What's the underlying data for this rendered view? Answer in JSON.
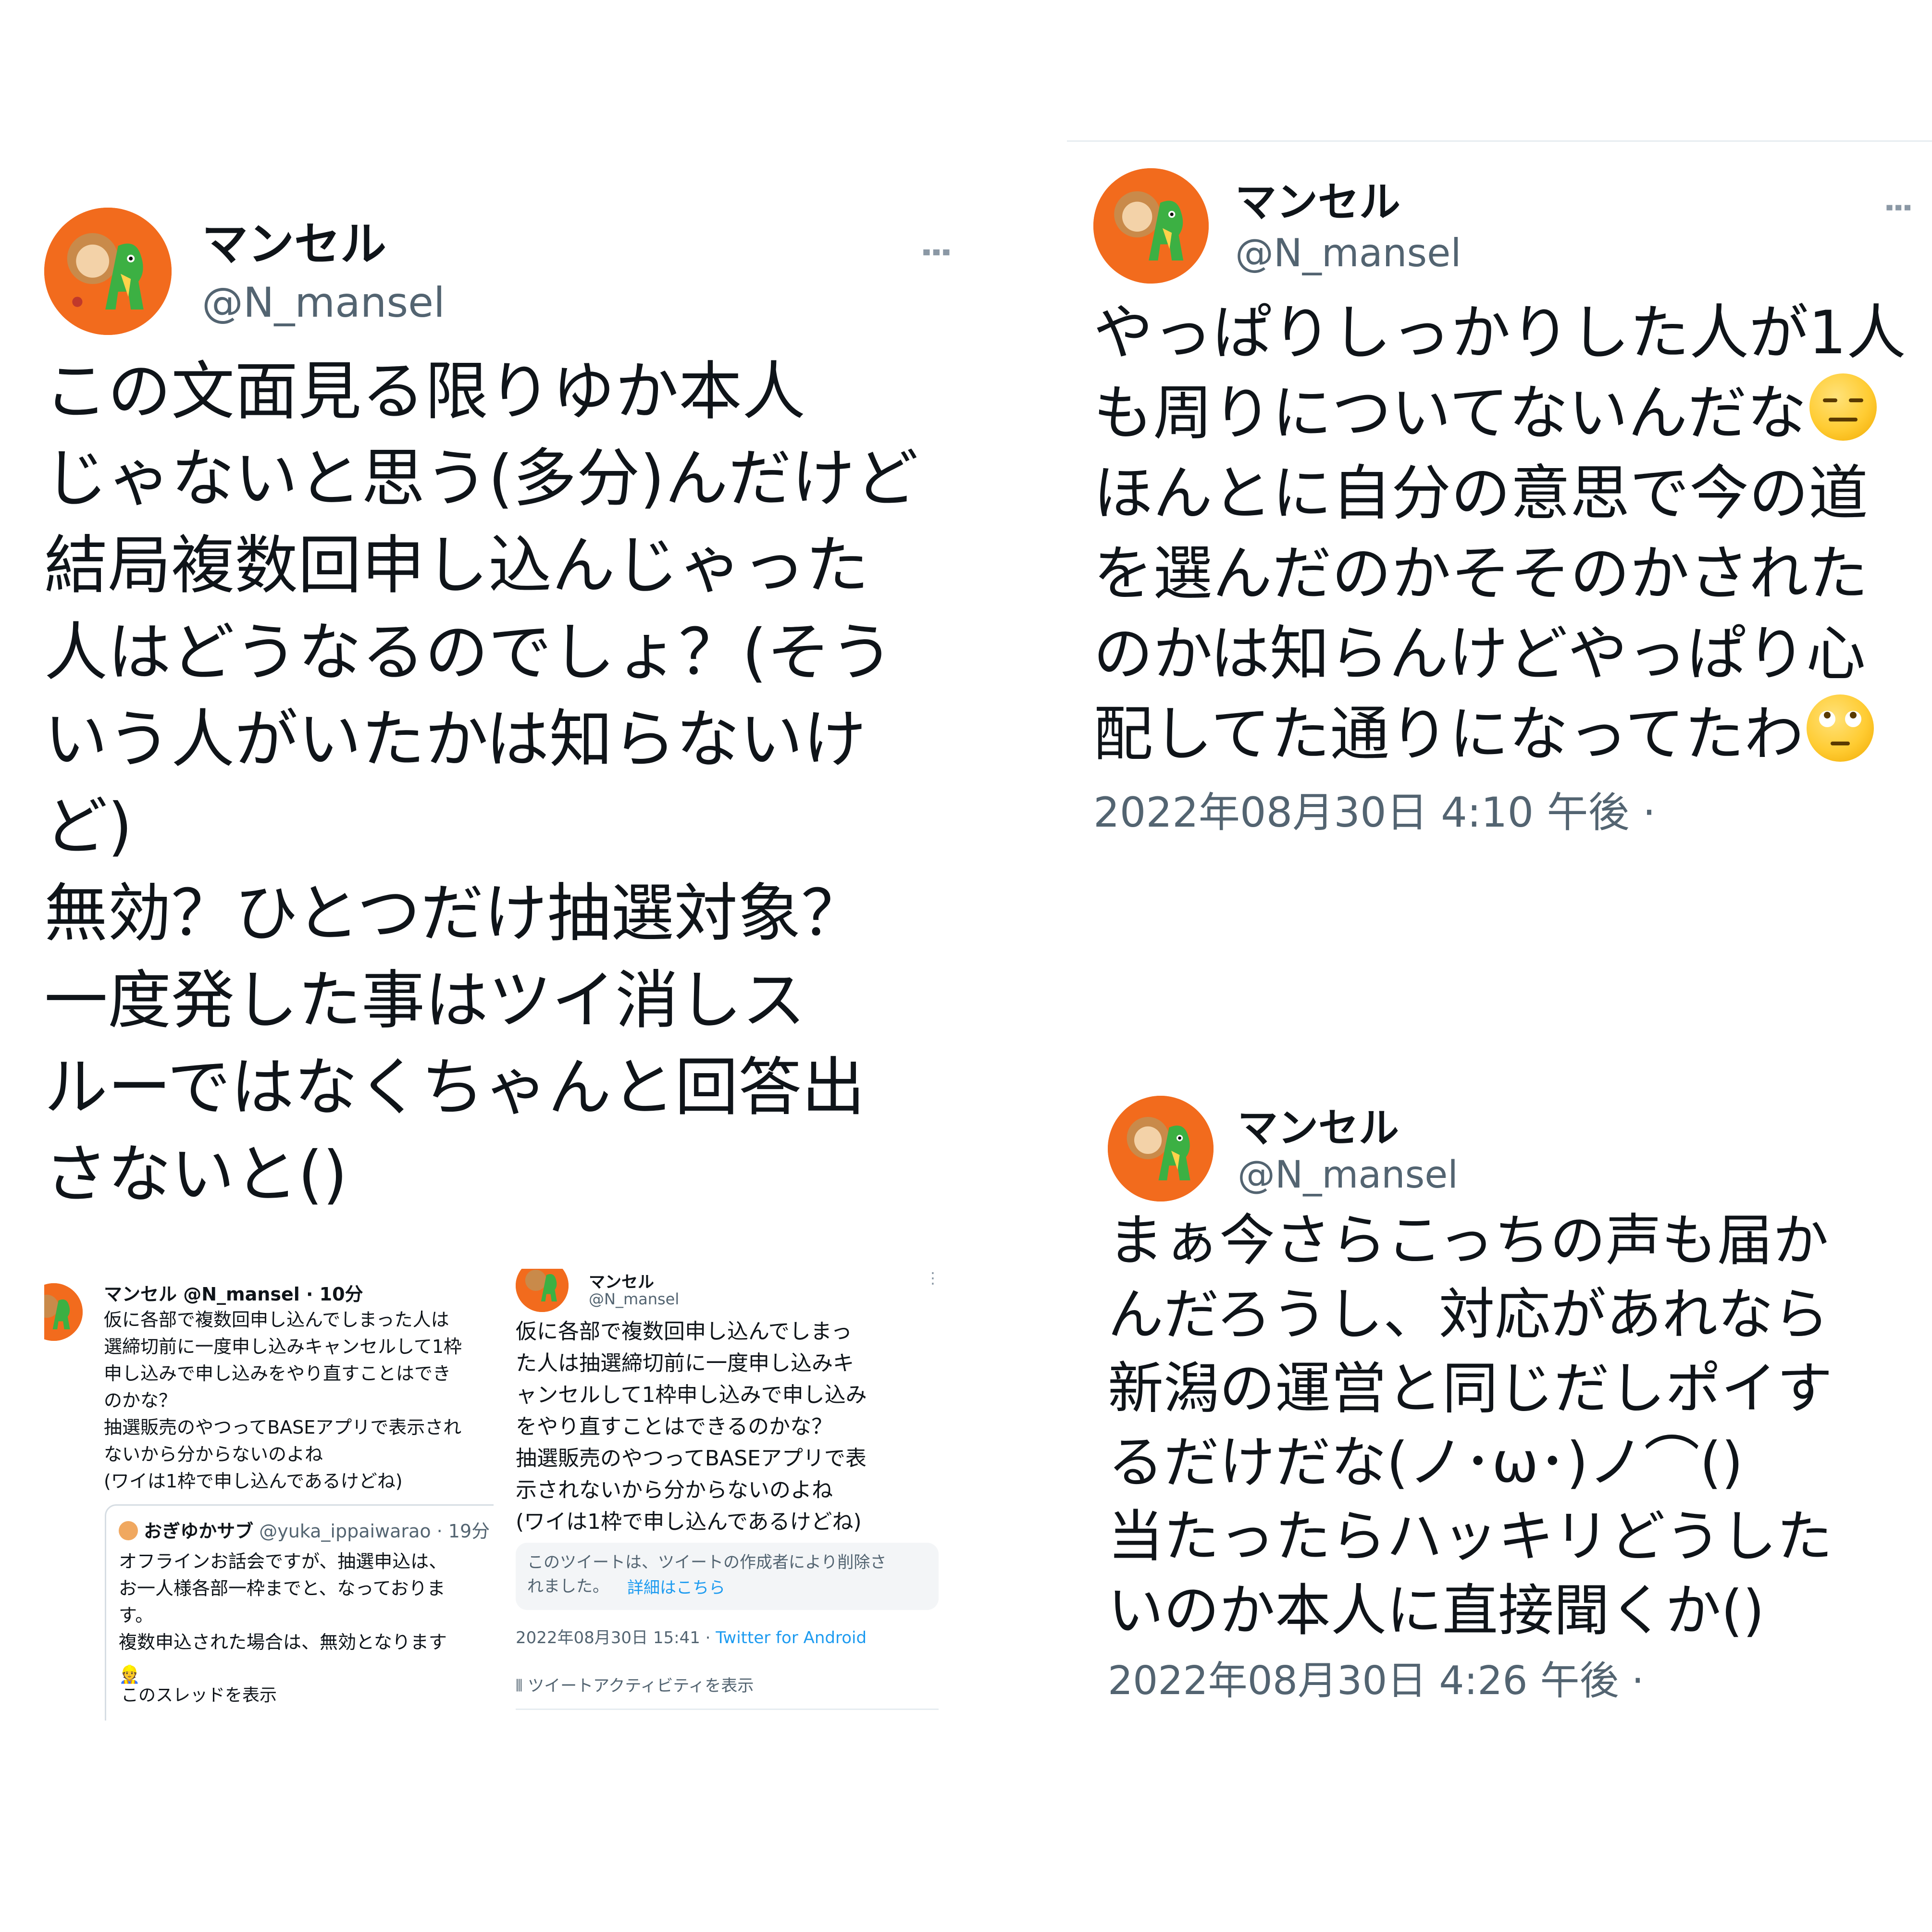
{
  "tweet_left": {
    "name": "マンセル",
    "handle": "@N_mansel",
    "more": "⋮",
    "body": "この文面見る限りゆか本人\nじゃないと思う(多分)んだけど\n結局複数回申し込んじゃった\n人はどうなるのでしょ？(そう\nいう人がいたかは知らないけ\nど)\n無効？ひとつだけ抽選対象？\n一度発した事はツイ消しス\nルーではなくちゃんと回答出\nさないと()"
  },
  "tweet_right_top": {
    "name": "マンセル",
    "handle": "@N_mansel",
    "more": "⋮",
    "lines": [
      "やっぱりしっかりした人が1人",
      "も周りについてないんだな",
      "ほんとに自分の意思で今の道",
      "を選んだのかそそのかされた",
      "のかは知らんけどやっぱり心",
      "配してた通りになってたわ"
    ],
    "emoji_1": "expressionless-face",
    "emoji_2": "face-with-rolling-eyes",
    "timestamp": "2022年08月30日 4:10 午後 ·"
  },
  "tweet_right_bottom": {
    "name": "マンセル",
    "handle": "@N_mansel",
    "body": "まぁ今さらこっちの声も届か\nんだろうし、対応があれなら\n新潟の運営と同じだしポイす\nるだけだな(ノ･ω･)ノ⌒()\n当たったらハッキリどうした\nいのか本人に直接聞くか()",
    "timestamp": "2022年08月30日 4:26 午後 ·"
  },
  "screenshot_a": {
    "header": "マンセル @N_mansel · 10分",
    "body": "仮に各部で複数回申し込んでしまった人は\n選締切前に一度申し込みキャンセルして1枠\n申し込みで申し込みをやり直すことはでき\nのかな？\n抽選販売のやつってBASEアプリで表示され\nないから分からないのよね\n(ワイは1枠で申し込んであるけどね)",
    "quote_name": "おぎゆかサブ",
    "quote_handle": "@yuka_ippaiwarao · 19分",
    "quote_body": "オフラインお話会ですが、抽選申込は、\nお一人様各部一枠までと、なっておりま\nす。\n複数申込された場合は、無効となります",
    "thread_link": "このスレッドを表示"
  },
  "screenshot_b": {
    "name": "マンセル",
    "handle": "@N_mansel",
    "body": "仮に各部で複数回申し込んでしまっ\nた人は抽選締切前に一度申し込みキ\nャンセルして1枠申し込みで申し込み\nをやり直すことはできるのかな？\n抽選販売のやつってBASEアプリで表\n示されないから分からないのよね\n(ワイは1枠で申し込んであるけどね)",
    "deleted_text": "このツイートは、ツイートの作成者により削除さ\nれました。",
    "deleted_link": "詳細はこちら",
    "timestamp": "2022年08月30日 15:41 · ",
    "client": "Twitter for Android",
    "activity": "ツイートアクティビティを表示"
  }
}
